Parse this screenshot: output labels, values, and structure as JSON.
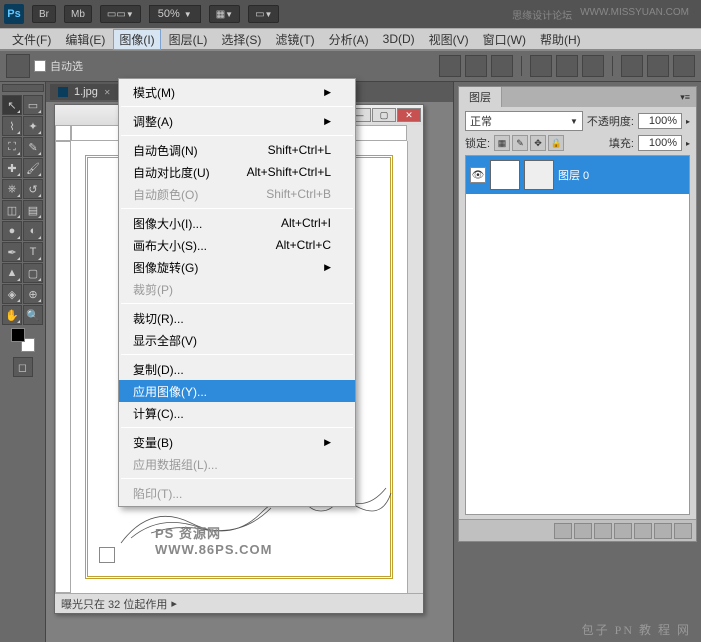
{
  "topbar": {
    "logo": "Ps",
    "btn_br": "Br",
    "btn_mb": "Mb",
    "zoom": "50%",
    "site_name": "思缘设计论坛",
    "site_url": "WWW.MISSYUAN.COM"
  },
  "menubar": {
    "items": [
      "文件(F)",
      "编辑(E)",
      "图像(I)",
      "图层(L)",
      "选择(S)",
      "滤镜(T)",
      "分析(A)",
      "3D(D)",
      "视图(V)",
      "窗口(W)",
      "帮助(H)"
    ]
  },
  "optionsbar": {
    "auto_label": "自动选"
  },
  "document": {
    "tab_name": "1.jpg",
    "watermark": "PS 资源网    WWW.86PS.COM",
    "status": "曝光只在 32 位起作用"
  },
  "dropdown": {
    "groups": [
      [
        {
          "label": "模式(M)",
          "shortcut": "",
          "submenu": true
        }
      ],
      [
        {
          "label": "调整(A)",
          "shortcut": "",
          "submenu": true
        }
      ],
      [
        {
          "label": "自动色调(N)",
          "shortcut": "Shift+Ctrl+L"
        },
        {
          "label": "自动对比度(U)",
          "shortcut": "Alt+Shift+Ctrl+L"
        },
        {
          "label": "自动颜色(O)",
          "shortcut": "Shift+Ctrl+B",
          "disabled": true
        }
      ],
      [
        {
          "label": "图像大小(I)...",
          "shortcut": "Alt+Ctrl+I"
        },
        {
          "label": "画布大小(S)...",
          "shortcut": "Alt+Ctrl+C"
        },
        {
          "label": "图像旋转(G)",
          "shortcut": "",
          "submenu": true
        },
        {
          "label": "裁剪(P)",
          "shortcut": "",
          "disabled": true
        }
      ],
      [
        {
          "label": "裁切(R)...",
          "shortcut": ""
        },
        {
          "label": "显示全部(V)",
          "shortcut": ""
        }
      ],
      [
        {
          "label": "复制(D)...",
          "shortcut": ""
        },
        {
          "label": "应用图像(Y)...",
          "shortcut": "",
          "hover": true
        },
        {
          "label": "计算(C)...",
          "shortcut": ""
        }
      ],
      [
        {
          "label": "变量(B)",
          "shortcut": "",
          "submenu": true
        },
        {
          "label": "应用数据组(L)...",
          "shortcut": "",
          "disabled": true
        }
      ],
      [
        {
          "label": "陷印(T)...",
          "shortcut": "",
          "disabled": true
        }
      ]
    ]
  },
  "layers_panel": {
    "tab": "图层",
    "blend_mode": "正常",
    "opacity_label": "不透明度:",
    "opacity_value": "100%",
    "lock_label": "锁定:",
    "fill_label": "填充:",
    "fill_value": "100%",
    "layers": [
      {
        "name": "图层 0"
      }
    ]
  },
  "bottom_watermark": "包子 PN  教 程 网"
}
